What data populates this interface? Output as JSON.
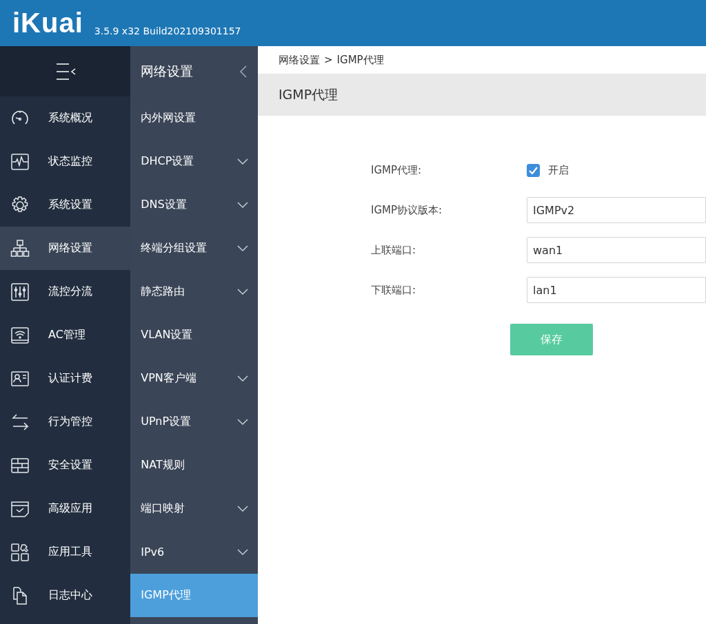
{
  "header": {
    "logo": "iKuai",
    "version": "3.5.9 x32 Build202109301157"
  },
  "nav": {
    "items": [
      {
        "label": "系统概况",
        "selected": false
      },
      {
        "label": "状态监控",
        "selected": false
      },
      {
        "label": "系统设置",
        "selected": false
      },
      {
        "label": "网络设置",
        "selected": true
      },
      {
        "label": "流控分流",
        "selected": false
      },
      {
        "label": "AC管理",
        "selected": false
      },
      {
        "label": "认证计费",
        "selected": false
      },
      {
        "label": "行为管控",
        "selected": false
      },
      {
        "label": "安全设置",
        "selected": false
      },
      {
        "label": "高级应用",
        "selected": false
      },
      {
        "label": "应用工具",
        "selected": false
      },
      {
        "label": "日志中心",
        "selected": false
      }
    ]
  },
  "subnav": {
    "title": "网络设置",
    "items": [
      {
        "label": "内外网设置",
        "expandable": false,
        "selected": false
      },
      {
        "label": "DHCP设置",
        "expandable": true,
        "selected": false
      },
      {
        "label": "DNS设置",
        "expandable": true,
        "selected": false
      },
      {
        "label": "终端分组设置",
        "expandable": true,
        "selected": false
      },
      {
        "label": "静态路由",
        "expandable": true,
        "selected": false
      },
      {
        "label": "VLAN设置",
        "expandable": false,
        "selected": false
      },
      {
        "label": "VPN客户端",
        "expandable": true,
        "selected": false
      },
      {
        "label": "UPnP设置",
        "expandable": true,
        "selected": false
      },
      {
        "label": "NAT规则",
        "expandable": false,
        "selected": false
      },
      {
        "label": "端口映射",
        "expandable": true,
        "selected": false
      },
      {
        "label": "IPv6",
        "expandable": true,
        "selected": false
      },
      {
        "label": "IGMP代理",
        "expandable": false,
        "selected": true
      }
    ]
  },
  "breadcrumb": {
    "items": [
      "网络设置",
      "IGMP代理"
    ],
    "separator": ">"
  },
  "page_title": "IGMP代理",
  "form": {
    "rows": [
      {
        "kind": "checkbox",
        "label": "IGMP代理:",
        "checked": true,
        "text": "开启"
      },
      {
        "kind": "input",
        "label": "IGMP协议版本:",
        "value": "IGMPv2"
      },
      {
        "kind": "input",
        "label": "上联端口:",
        "value": "wan1"
      },
      {
        "kind": "input",
        "label": "下联端口:",
        "value": "lan1"
      }
    ],
    "save_button": "保存"
  }
}
